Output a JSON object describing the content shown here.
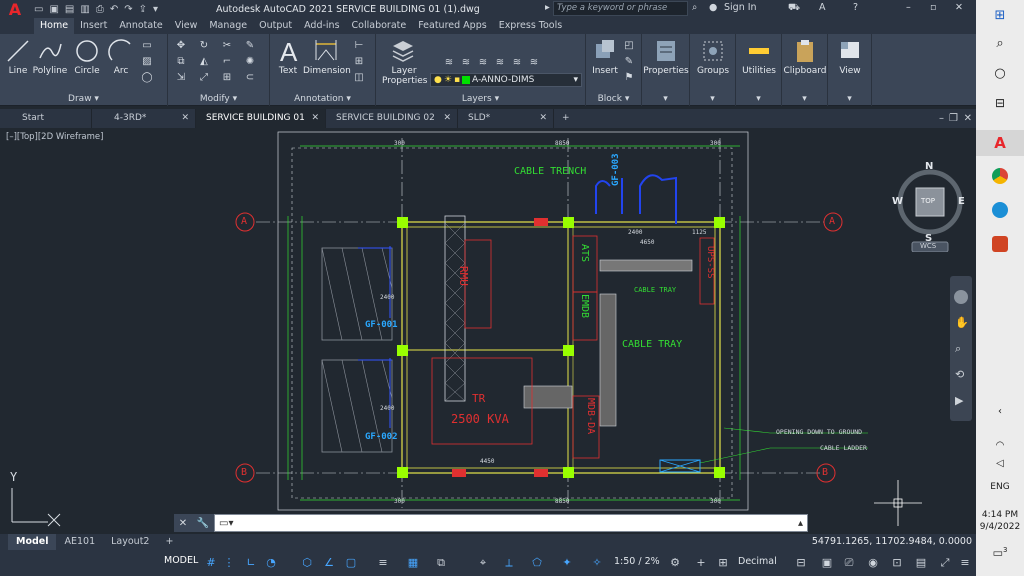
{
  "titlebar": {
    "app_logo": "A",
    "title": "Autodesk AutoCAD 2021   SERVICE BUILDING 01 (1).dwg",
    "search_placeholder": "Type a keyword or phrase",
    "sign_in": "Sign In",
    "icons": [
      "new-icon",
      "open-icon",
      "save-icon",
      "undo-icon",
      "redo-icon",
      "search-icon",
      "user-icon",
      "cart-icon",
      "help-icon",
      "minimize-icon",
      "maximize-icon",
      "close-icon"
    ]
  },
  "ribbon_tabs": [
    "Home",
    "Insert",
    "Annotate",
    "View",
    "Manage",
    "Output",
    "Add-ins",
    "Collaborate",
    "Featured Apps",
    "Express Tools"
  ],
  "ribbon": {
    "draw": {
      "title": "Draw",
      "tools": [
        "Line",
        "Polyline",
        "Circle",
        "Arc"
      ]
    },
    "modify": {
      "title": "Modify"
    },
    "annotation": {
      "title": "Annotation",
      "tools": [
        "Text",
        "Dimension"
      ]
    },
    "layers": {
      "title": "Layers",
      "tool": "Layer Properties",
      "current_layer": "A-ANNO-DIMS"
    },
    "block": {
      "title": "Block",
      "tool": "Insert"
    },
    "extra_tools": [
      "Properties",
      "Groups",
      "Utilities",
      "Clipboard",
      "View"
    ]
  },
  "doc_tabs": [
    {
      "label": "Start",
      "closable": false
    },
    {
      "label": "4-3RD*",
      "closable": true
    },
    {
      "label": "SERVICE BUILDING 01 (1)*",
      "closable": true,
      "active": true
    },
    {
      "label": "SERVICE BUILDING 02 (1)*",
      "closable": true
    },
    {
      "label": "SLD*",
      "closable": true
    }
  ],
  "viewport": {
    "label": "[–][Top][2D Wireframe]",
    "viewcube": {
      "north": "N",
      "south": "S",
      "east": "E",
      "west": "W",
      "face": "TOP",
      "wcs": "WCS"
    }
  },
  "drawing": {
    "grid_labels": [
      "A",
      "A",
      "B",
      "B"
    ],
    "labels": {
      "cable_trench": "CABLE  TRENCH",
      "rmu": "RMU",
      "ats": "ATS",
      "emdb": "EMDB",
      "ups": "UPS-SS",
      "cable_tray_1": "CABLE  TRAY",
      "cable_tray_2": "CABLE  TRAY",
      "tr": "TR",
      "kva": "2500  KVA",
      "mdb": "MDB-DA",
      "gf001": "GF-001",
      "gf002": "GF-002",
      "gf003": "GF-003",
      "opening": "OPENING DOWN TO GROUND",
      "cable_ladder": "CABLE LADDER",
      "axis_y": "Y",
      "dims": [
        "8850",
        "8850",
        "2400",
        "1125",
        "4650",
        "2400",
        "2400",
        "4450",
        "300",
        "300",
        "300",
        "300"
      ]
    }
  },
  "command_line": {
    "value": ""
  },
  "layout_tabs": [
    "Model",
    "AE101",
    "Layout2"
  ],
  "coordinates": "54791.1265, 11702.9484, 0.0000",
  "statusbar": {
    "model": "MODEL",
    "scale": "1:50 / 2%",
    "units": "Decimal"
  },
  "taskbar": {
    "time": "4:14 PM",
    "date": "9/4/2022",
    "language": "ENG",
    "notifications": "3"
  }
}
